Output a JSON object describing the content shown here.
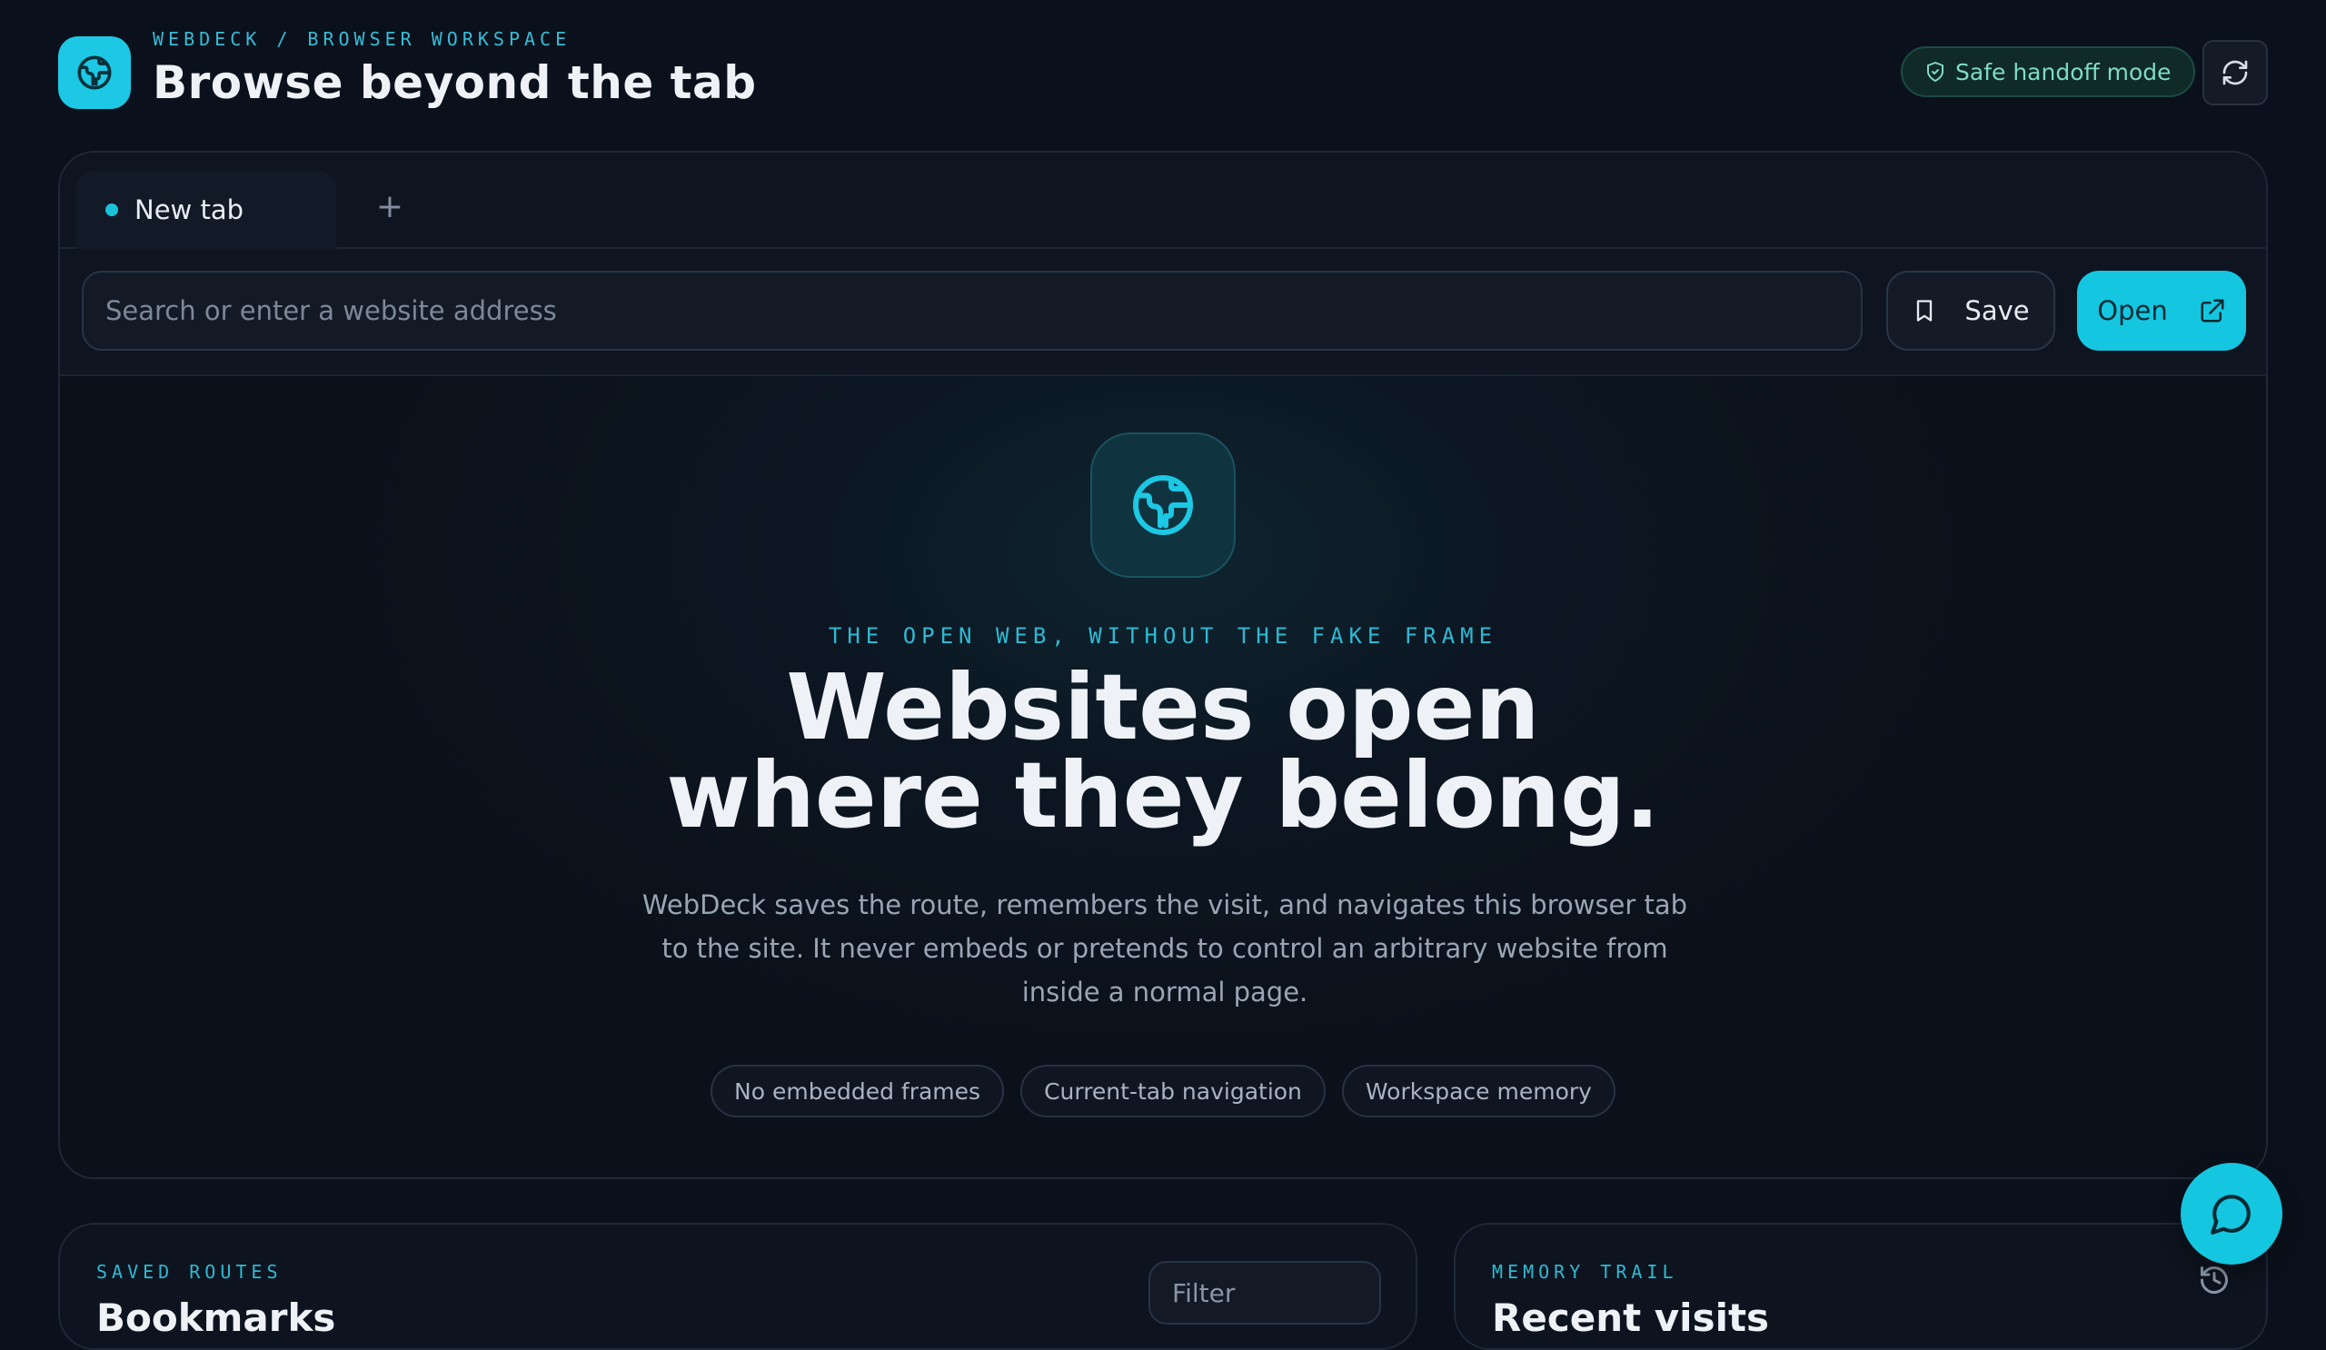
{
  "header": {
    "breadcrumb": "WEBDECK / BROWSER WORKSPACE",
    "title": "Browse beyond the tab",
    "safe_mode_label": "Safe handoff mode",
    "logo_icon": "globe-icon",
    "refresh_icon": "refresh-icon"
  },
  "tabs": {
    "items": [
      {
        "label": "New tab",
        "active": true
      }
    ],
    "add_label": "+"
  },
  "address_bar": {
    "placeholder": "Search or enter a website address",
    "value": "",
    "save_label": "Save",
    "open_label": "Open"
  },
  "hero": {
    "eyebrow": "THE OPEN WEB, WITHOUT THE FAKE FRAME",
    "headline_line1": "Websites open",
    "headline_line2": "where they belong.",
    "description": "WebDeck saves the route, remembers the visit, and navigates this browser tab to the site. It never embeds or pretends to control an arbitrary website from inside a normal page.",
    "chips": [
      "No embedded frames",
      "Current-tab navigation",
      "Workspace memory"
    ]
  },
  "saved_routes": {
    "eyebrow": "SAVED ROUTES",
    "title": "Bookmarks",
    "filter_placeholder": "Filter"
  },
  "memory_trail": {
    "eyebrow": "MEMORY TRAIL",
    "title": "Recent visits"
  },
  "colors": {
    "accent": "#14c6e0",
    "background": "#0b111c",
    "safe_badge_text": "#7fdcc0"
  }
}
